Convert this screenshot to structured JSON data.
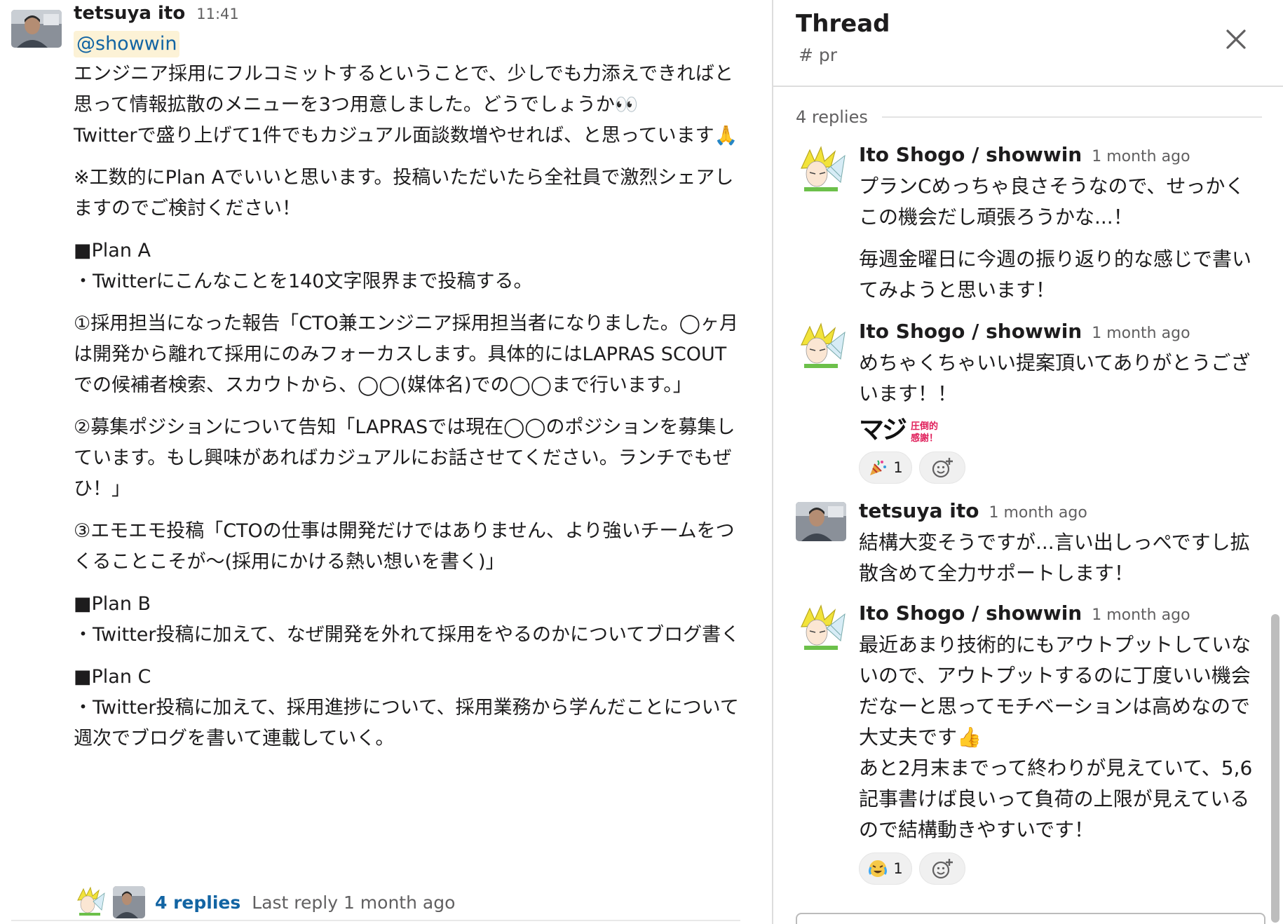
{
  "main": {
    "author": "tetsuya ito",
    "time": "11:41",
    "mention": "@showwin",
    "paragraphs": [
      "エンジニア採用にフルコミットするということで、少しでも力添えできればと思って情報拡散のメニューを3つ用意しました。どうでしょうか👀\nTwitterで盛り上げて1件でもカジュアル面談数増やせれば、と思っています🙏",
      "※工数的にPlan Aでいいと思います。投稿いただいたら全社員で激烈シェアしますのでご検討ください！",
      "■Plan A\n・Twitterにこんなことを140文字限界まで投稿する。",
      "①採用担当になった報告「CTO兼エンジニア採用担当者になりました。◯ヶ月は開発から離れて採用にのみフォーカスします。具体的にはLAPRAS SCOUTでの候補者検索、スカウトから、◯◯(媒体名)での◯◯まで行います。」",
      "②募集ポジションについて告知「LAPRASでは現在◯◯のポジションを募集しています。もし興味があればカジュアルにお話させてください。ランチでもぜひ！」",
      "③エモエモ投稿「CTOの仕事は開発だけではありません、より強いチームをつくることこそが〜(採用にかける熱い想いを書く)」",
      "■Plan B\n・Twitter投稿に加えて、なぜ開発を外れて採用をやるのかについてブログ書く",
      "■Plan C\n・Twitter投稿に加えて、採用進捗について、採用業務から学んだことについて週次でブログを書いて連載していく。"
    ],
    "replies_link": "4 replies",
    "last_reply": "Last reply 1 month ago"
  },
  "thread": {
    "title": "Thread",
    "channel": "# pr",
    "replies_count": "4 replies",
    "messages": [
      {
        "author": "Ito Shogo / showwin",
        "time": "1 month ago",
        "paragraphs": [
          "プランCめっちゃ良さそうなので、せっかくこの機会だし頑張ろうかな...！",
          "毎週金曜日に今週の振り返り的な感じで書いてみようと思います！"
        ]
      },
      {
        "author": "Ito Shogo / showwin",
        "time": "1 month ago",
        "paragraphs": [
          "めちゃくちゃいい提案頂いてありがとうございます！！"
        ],
        "sticker": {
          "big": "マジ",
          "small1": "圧倒的",
          "small2": "感謝！"
        },
        "reaction": {
          "emoji": "party-horn-icon",
          "count": "1"
        }
      },
      {
        "author": "tetsuya ito",
        "time": "1 month ago",
        "paragraphs": [
          "結構大変そうですが...言い出しっぺですし拡散含めて全力サポートします！"
        ]
      },
      {
        "author": "Ito Shogo / showwin",
        "time": "1 month ago",
        "paragraphs": [
          "最近あまり技術的にもアウトプットしていないので、アウトプットするのに丁度いい機会だなーと思ってモチベーションは高めなので大丈夫です👍\nあと2月末までって終わりが見えていて、5,6記事書けば良いって負荷の上限が見えているので結構動きやすいです！"
        ],
        "reaction": {
          "emoji": "crying-laughing-face-icon",
          "count": "1"
        }
      }
    ]
  },
  "colors": {
    "link": "#1264a3",
    "mention_bg": "#fcf2d6",
    "muted": "#616061",
    "text": "#1d1c1d"
  }
}
